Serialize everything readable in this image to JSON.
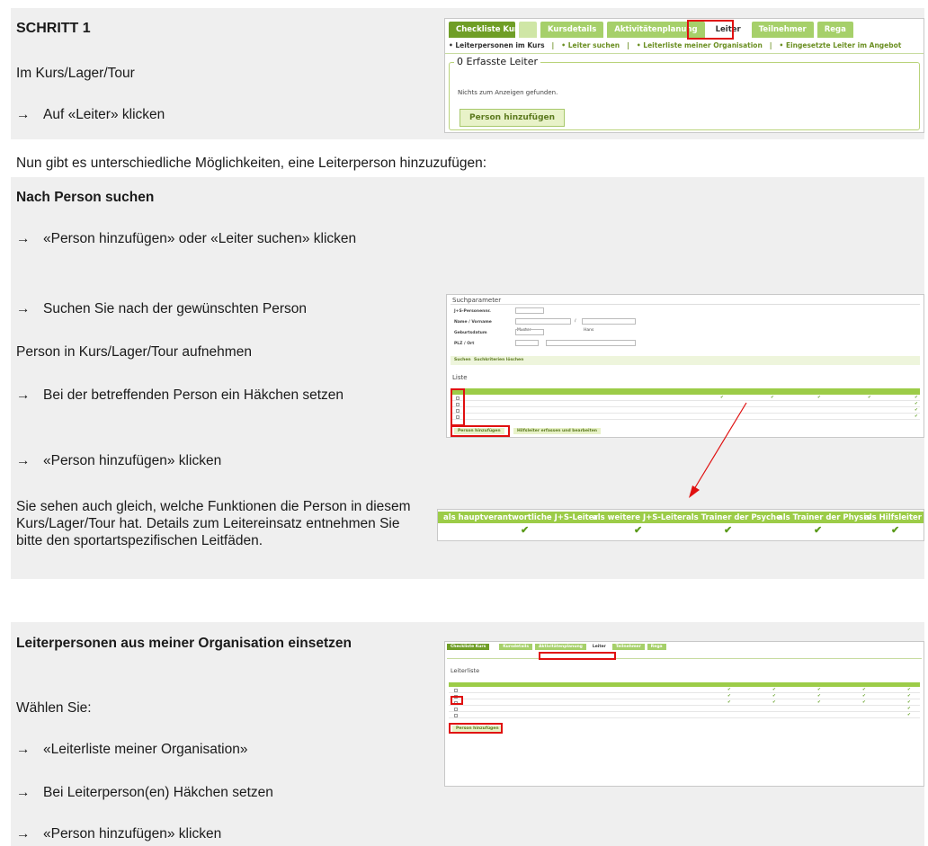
{
  "schritt": {
    "title": "SCHRITT 1",
    "line1": "Im Kurs/Lager/Tour",
    "line2": "Auf «Leiter» klicken"
  },
  "intro": "Nun gibt es unterschiedliche Möglichkeiten, eine Leiterperson hinzuzufügen:",
  "search_section": {
    "title": "Nach Person suchen",
    "bullet1": "«Person hinzufügen» oder «Leiter suchen» klicken",
    "bullet2": "Suchen Sie nach der gewünschten Person",
    "subhead": "Person in Kurs/Lager/Tour aufnehmen",
    "bullet3": "Bei der betreffenden Person ein Häkchen setzen",
    "bullet4": "«Person hinzufügen» klicken",
    "paragraph": "Sie sehen auch gleich, welche Funktionen die Person in diesem Kurs/Lager/Tour hat. Details zum Leitereinsatz entnehmen Sie bitte den sportartspezifischen Leitfäden."
  },
  "org_section": {
    "title": "Leiterpersonen aus meiner Organisation einsetzen",
    "subhead": "Wählen Sie:",
    "bullet1": "«Leiterliste meiner Organisation»",
    "bullet2": "Bei Leiterperson(en) Häkchen setzen",
    "bullet3": "«Person hinzufügen» klicken"
  },
  "arrow_glyph": "→",
  "shot1": {
    "tabs": [
      "Checkliste Kurs",
      "Kursdetails",
      "Aktivitätenplanung",
      "Leiter",
      "Teilnehmer",
      "Rega"
    ],
    "subnav": [
      "• Leiterpersonen im Kurs",
      "• Leiter suchen",
      "• Leiterliste meiner Organisation",
      "• Eingesetzte Leiter im Angebot"
    ],
    "legend": "0 Erfasste Leiter",
    "empty": "Nichts zum Anzeigen gefunden.",
    "button": "Person hinzufügen"
  },
  "shot2": {
    "legend": "Suchparameter",
    "fields": [
      "J+S-Personennr.",
      "Name / Vorname",
      "Geburtsdatum",
      "PLZ / Ort"
    ],
    "name_value": "Muster",
    "vorname_value": "Hans",
    "search_btn": "Suchen",
    "reset_btn": "Suchkriterien löschen",
    "list_title": "Liste",
    "add_btn": "Person hinzufügen",
    "add_btn2": "Hilfsleiter erfassen und bearbeiten"
  },
  "shot3": {
    "headers": [
      "als hauptverantwortliche J+S-Leiter",
      "als weitere J+S-Leiter",
      "als Trainer der Psyche",
      "als Trainer der Physis",
      "als Hilfsleiter"
    ],
    "check": "✔"
  },
  "shot4": {
    "tabs": [
      "Checkliste Kurs",
      "Kursdetails",
      "Aktivitätenplanung",
      "Leiter",
      "Teilnehmer",
      "Rega"
    ],
    "list_title": "Leiterliste",
    "add_btn": "Person hinzufügen"
  }
}
